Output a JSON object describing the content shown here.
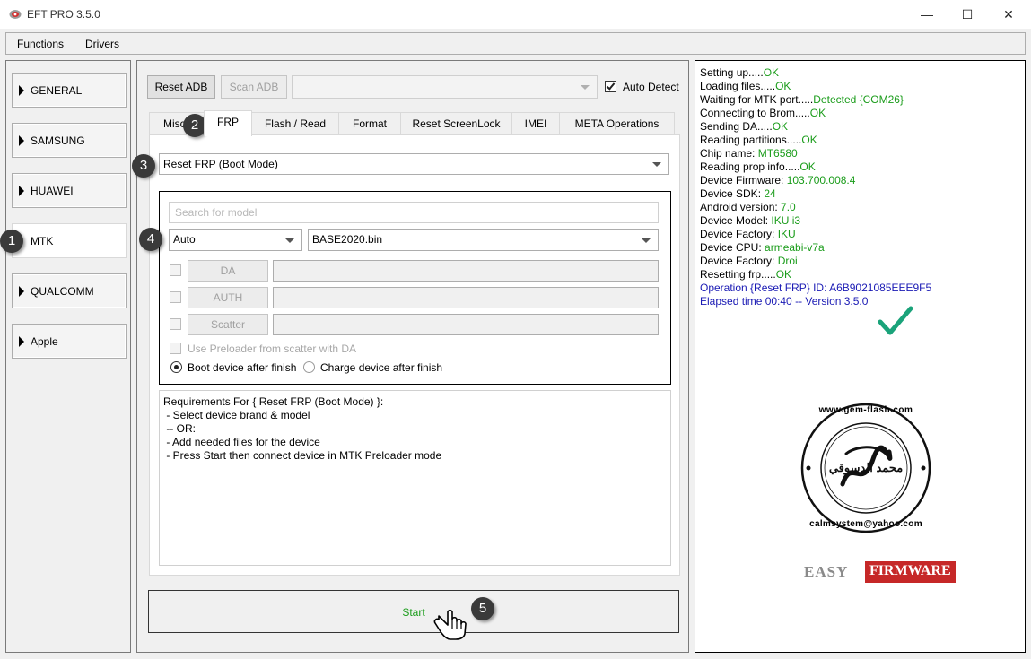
{
  "window": {
    "title": "EFT PRO 3.5.0",
    "minimize": "—",
    "maximize": "☐",
    "close": "✕"
  },
  "menu": [
    "Functions",
    "Drivers"
  ],
  "brands": [
    "GENERAL",
    "SAMSUNG",
    "HUAWEI",
    "MTK",
    "QUALCOMM",
    "Apple"
  ],
  "active_brand": "MTK",
  "toolbar": {
    "reset_adb": "Reset ADB",
    "scan_adb": "Scan ADB",
    "port_value": "",
    "auto_detect_label": "Auto Detect",
    "auto_detect_checked": true
  },
  "tabs": [
    "Misc",
    "FRP",
    "Flash / Read",
    "Format",
    "Reset ScreenLock",
    "IMEI",
    "META Operations"
  ],
  "active_tab": "FRP",
  "frp": {
    "operation": "Reset FRP (Boot Mode)",
    "search_placeholder": "Search for model",
    "mode_value": "Auto",
    "file_value": "BASE2020.bin",
    "da_label": "DA",
    "auth_label": "AUTH",
    "scatter_label": "Scatter",
    "preloader_label": "Use Preloader from scatter with DA",
    "boot_label": "Boot device after finish",
    "charge_label": "Charge device after finish",
    "requirements": [
      "Requirements For { Reset FRP (Boot Mode) }:",
      " - Select device brand & model",
      " -- OR:",
      " - Add needed files for the device",
      " - Press Start then connect device in MTK Preloader mode"
    ],
    "start_label": "Start"
  },
  "log": [
    {
      "label": "Setting up.....",
      "value": "OK"
    },
    {
      "label": "Loading files.....",
      "value": "OK"
    },
    {
      "label": "Waiting for MTK port.....",
      "value": "Detected {COM26}"
    },
    {
      "label": "Connecting to Brom.....",
      "value": "OK"
    },
    {
      "label": "Sending DA.....",
      "value": "OK"
    },
    {
      "label": "Reading partitions.....",
      "value": "OK"
    },
    {
      "label": "Chip name: ",
      "value": "MT6580"
    },
    {
      "label": "Reading prop info.....",
      "value": "OK"
    },
    {
      "label": "Device Firmware: ",
      "value": "103.700.008.4"
    },
    {
      "label": "Device SDK: ",
      "value": "24"
    },
    {
      "label": "Android version: ",
      "value": "7.0"
    },
    {
      "label": "Device Model: ",
      "value": "IKU i3"
    },
    {
      "label": "Device Factory: ",
      "value": "IKU"
    },
    {
      "label": "Device CPU: ",
      "value": "armeabi-v7a"
    },
    {
      "label": "Device Factory: ",
      "value": "Droi"
    },
    {
      "label": "Resetting frp.....",
      "value": "OK"
    }
  ],
  "log_summary": [
    "Operation {Reset FRP} ID: A6B9021085EEE9F5",
    "Elapsed time 00:40 -- Version 3.5.0"
  ],
  "watermark": {
    "ring_top": "www.gem-flash.com",
    "ring_bottom": "calmsystem@yahoo.com",
    "center_script": "محمد الدسوقي",
    "brand_a": "EASY",
    "brand_b": "FIRMWARE"
  },
  "annotations": [
    "1",
    "2",
    "3",
    "4",
    "5"
  ],
  "colors": {
    "ok": "#1a9c1a",
    "summary": "#1a1ab4",
    "checkmark": "#1aa37a",
    "firmware_red": "#c62828"
  }
}
